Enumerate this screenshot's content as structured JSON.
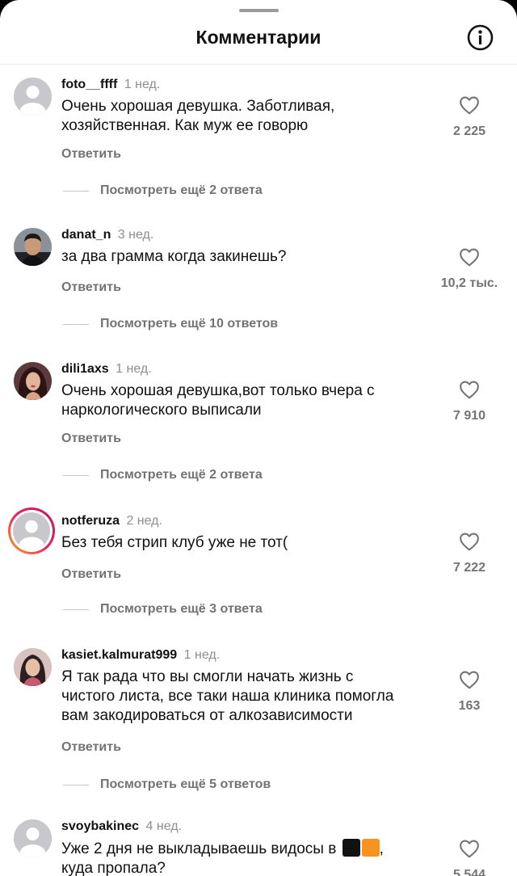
{
  "header": {
    "title": "Комментарии",
    "info_icon": "info-circle-icon"
  },
  "comments": [
    {
      "username": "foto__ffff",
      "time": "1 нед.",
      "lines": [
        "Очень хорошая девушка. Заботливая,",
        "хозяйственная. Как муж ее говорю"
      ],
      "reply_label": "Ответить",
      "view_replies": "Посмотреть ещё 2 ответа",
      "likes": "2 225",
      "avatar": "default-avatar"
    },
    {
      "username": "danat_n",
      "time": "3 нед.",
      "lines": [
        "за два грамма когда закинешь?"
      ],
      "reply_label": "Ответить",
      "view_replies": "Посмотреть ещё 10 ответов",
      "likes": "10,2 тыс.",
      "avatar": "photo-man"
    },
    {
      "username": "dili1axs",
      "time": "1 нед.",
      "lines": [
        "Очень хорошая девушка,вот только вчера с",
        "наркологического выписали"
      ],
      "reply_label": "Ответить",
      "view_replies": "Посмотреть ещё 2 ответа",
      "likes": "7 910",
      "avatar": "photo-woman"
    },
    {
      "username": "notferuza",
      "time": "2 нед.",
      "lines": [
        "Без тебя стрип клуб уже не тот("
      ],
      "reply_label": "Ответить",
      "view_replies": "Посмотреть ещё 3 ответа",
      "likes": "7 222",
      "avatar": "default-avatar-story"
    },
    {
      "username": "kasiet.kalmurat999",
      "time": "1 нед.",
      "lines": [
        "Я так рада что вы смогли начать жизнь с",
        "чистого листа, все таки наша клиника помогла",
        "вам закодироваться от алкозависимости"
      ],
      "reply_label": "Ответить",
      "view_replies": "Посмотреть ещё 5 ответов",
      "likes": "163",
      "avatar": "photo-woman-2"
    },
    {
      "username": "svoybakinec",
      "time": "4 нед.",
      "lines": [
        "Уже 2 дня не выкладываешь видосы в",
        "куда пропала?"
      ],
      "emoji": [
        "black-square",
        "orange-square"
      ],
      "likes": "5 544",
      "avatar": "default-avatar"
    }
  ],
  "colors": {
    "story_ring": "#e91e63",
    "muted": "#737373",
    "orange": "#f7931e"
  }
}
